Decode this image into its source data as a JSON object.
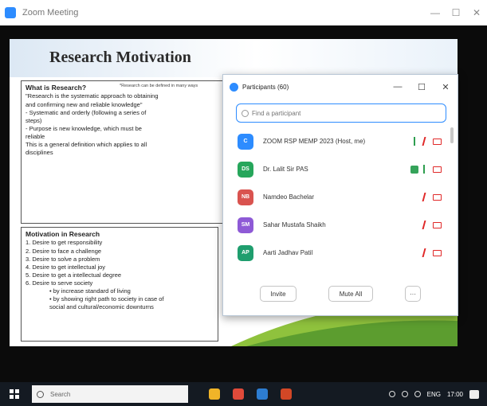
{
  "window": {
    "title": "Zoom Meeting",
    "controls": [
      "—",
      "☐",
      "✕"
    ]
  },
  "slide": {
    "title": "Research Motivation",
    "box1": {
      "heading": "What is Research?",
      "note": "*Research can be defined in many ways",
      "lines": [
        "\"Research is the systematic approach to obtaining",
        "and confirming new and reliable knowledge\"",
        "- Systematic and orderly (following a series of",
        "steps)",
        "- Purpose is new knowledge, which must be",
        "reliable",
        "This is a general definition which applies to all",
        "disciplines"
      ]
    },
    "box2": {
      "heading": "Motivation in Research",
      "items": [
        "1. Desire to get responsibility",
        "2. Desire to face a challenge",
        "3. Desire to solve a problem",
        "4. Desire to get intellectual joy",
        "5. Desire to get a intellectual degree",
        "6. Desire to serve society"
      ],
      "subitems": [
        "• by increase standard of living",
        "• by showing right path to society in case of",
        "social and cultural/economic downturns"
      ]
    }
  },
  "participants": {
    "title": "Participants (60)",
    "controls": [
      "—",
      "☐",
      "✕"
    ],
    "search_placeholder": "Find a participant",
    "rows": [
      {
        "initials": "C",
        "name": "ZOOM RSP MEMP 2023 (Host, me)",
        "color": "#2d8cff",
        "indicator": "mic-on"
      },
      {
        "initials": "DS",
        "name": "Dr. Lalit Sir PAS",
        "color": "#26a65b",
        "indicator": "hand"
      },
      {
        "initials": "NB",
        "name": "Namdeo Bachelar",
        "color": "#d9534f",
        "indicator": "mic-off"
      },
      {
        "initials": "SM",
        "name": "Sahar Mustafa Shaikh",
        "color": "#8e5ad6",
        "indicator": "mic-off"
      },
      {
        "initials": "AP",
        "name": "Aarti Jadhav Patil",
        "color": "#1f9e6e",
        "indicator": "mic-off"
      }
    ],
    "footer": {
      "invite": "Invite",
      "mute_all": "Mute All",
      "more": "···"
    }
  },
  "taskbar": {
    "search_placeholder": "Search",
    "apps": [
      {
        "name": "file-explorer-icon",
        "color": "#f0b428"
      },
      {
        "name": "chrome-icon",
        "color": "#e04a3a"
      },
      {
        "name": "store-icon",
        "color": "#2d7dd2"
      },
      {
        "name": "ppt-icon",
        "color": "#d24726"
      }
    ],
    "time": "17:00",
    "tray_text": "ENG"
  }
}
